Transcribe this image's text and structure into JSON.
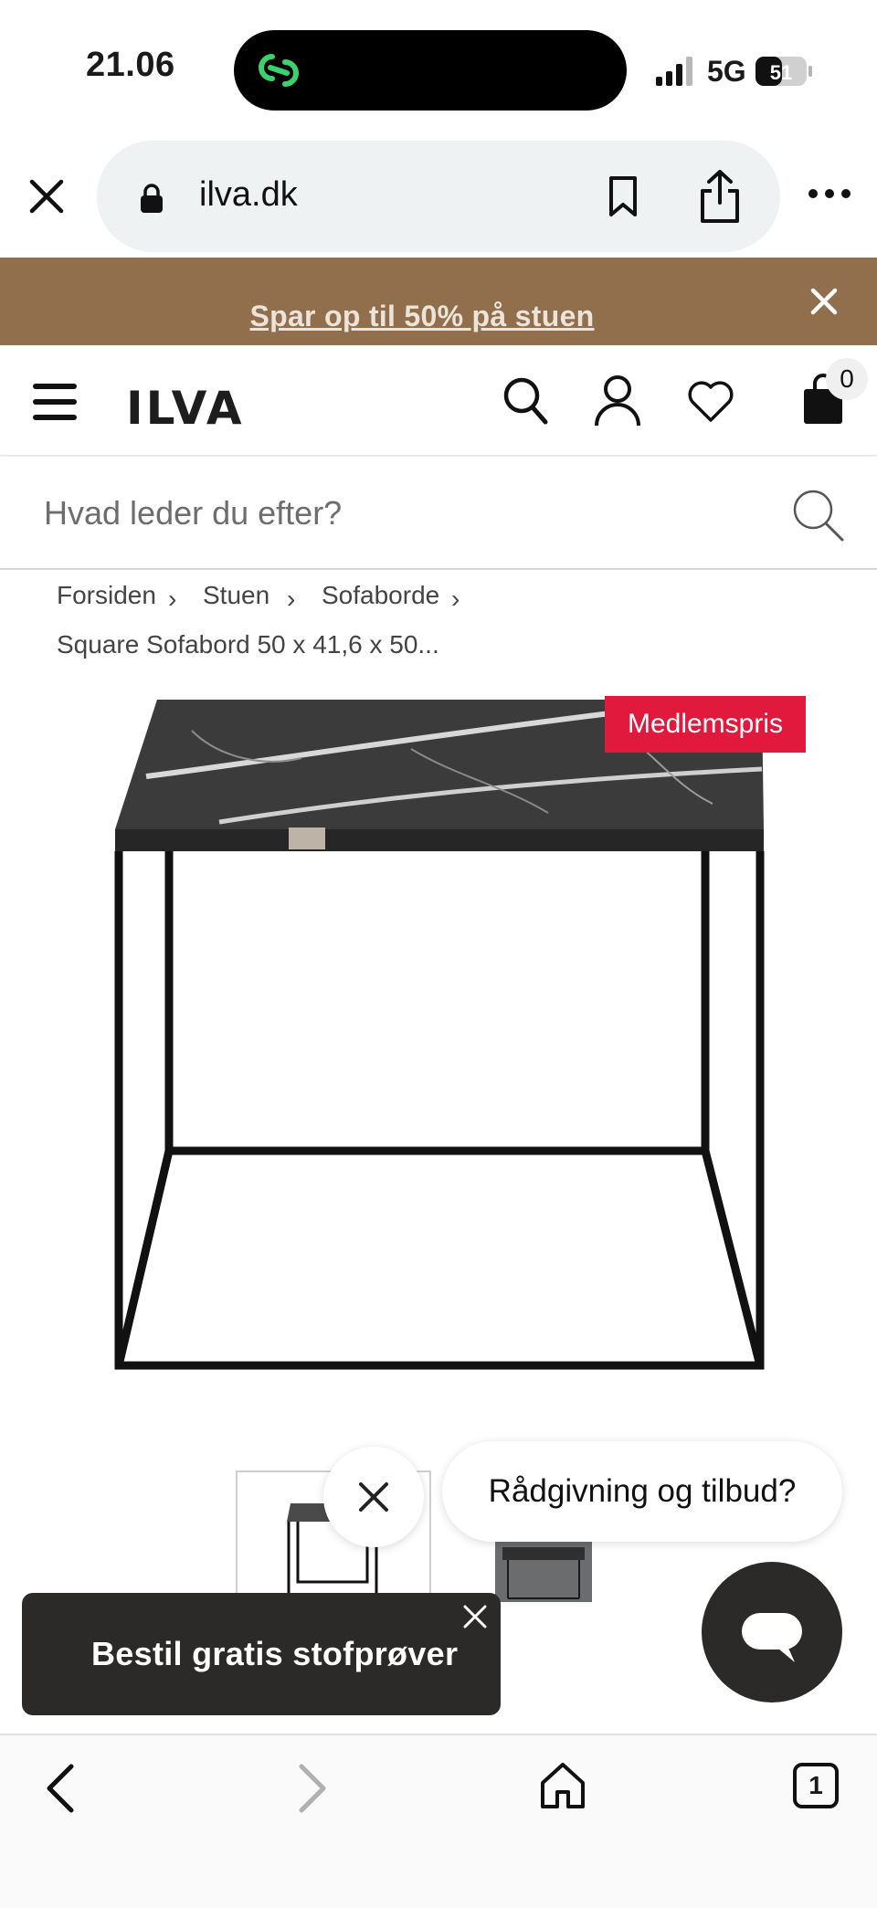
{
  "status_bar": {
    "time": "21.06",
    "network": "5G",
    "battery": "51"
  },
  "browser": {
    "url": "ilva.dk"
  },
  "promo": {
    "text": "Spar op til 50% på stuen"
  },
  "header": {
    "logo": "ILVA",
    "cart_count": "0"
  },
  "search": {
    "placeholder": "Hvad leder du efter?"
  },
  "breadcrumb": {
    "items": [
      "Forsiden",
      "Stuen",
      "Sofaborde"
    ],
    "separator": "›",
    "current": "Square Sofabord 50 x 41,6 x 50..."
  },
  "product": {
    "badge": "Medlemspris"
  },
  "chat": {
    "prompt": "Rådgivning og tilbud?"
  },
  "toast": {
    "text": "Bestil gratis stofprøver"
  },
  "bottom_bar": {
    "tab_count": "1"
  },
  "colors": {
    "promo_bg": "#916e4c",
    "badge_bg": "#e0193d",
    "dark": "#2c2a28"
  }
}
